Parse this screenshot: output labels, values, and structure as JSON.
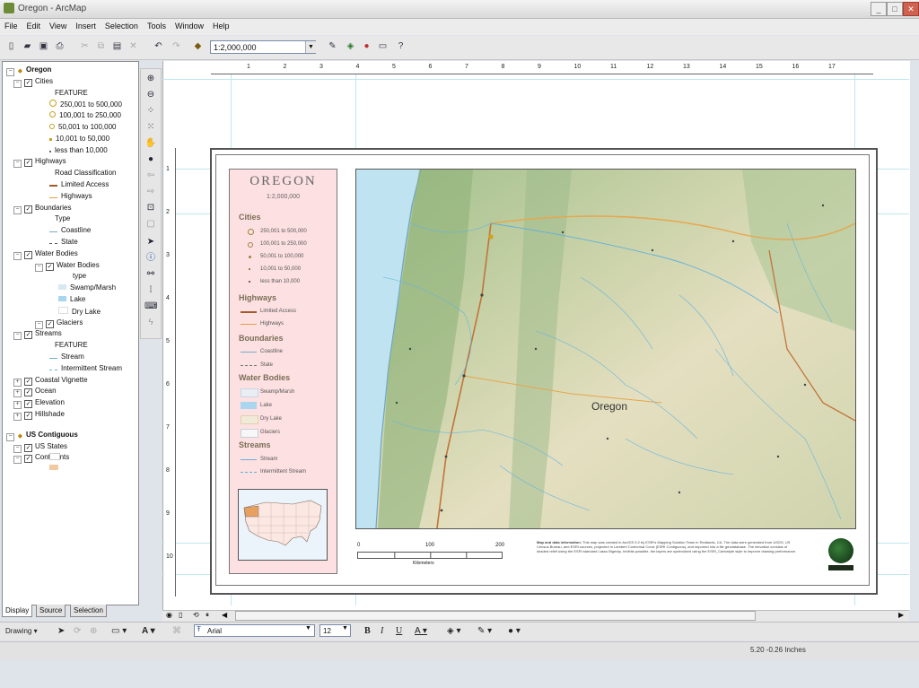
{
  "window": {
    "title": "Oregon - ArcMap"
  },
  "menu": [
    "File",
    "Edit",
    "View",
    "Insert",
    "Selection",
    "Tools",
    "Window",
    "Help"
  ],
  "toolbar": {
    "scale": "1:2,000,000"
  },
  "toc": {
    "items": [
      {
        "label": "Oregon",
        "kind": "frame"
      },
      {
        "label": "Cities",
        "kind": "layer"
      },
      {
        "label": "FEATURE",
        "kind": "sub"
      },
      {
        "label": "250,001 to 500,000",
        "kind": "class"
      },
      {
        "label": "100,001 to 250,000",
        "kind": "class"
      },
      {
        "label": "50,001 to 100,000",
        "kind": "class"
      },
      {
        "label": "10,001 to 50,000",
        "kind": "class"
      },
      {
        "label": "less than 10,000",
        "kind": "class"
      },
      {
        "label": "Highways",
        "kind": "layer"
      },
      {
        "label": "Road Classification",
        "kind": "sub"
      },
      {
        "label": "Limited Access",
        "kind": "class"
      },
      {
        "label": "Highways",
        "kind": "class"
      },
      {
        "label": "Boundaries",
        "kind": "layer"
      },
      {
        "label": "Type",
        "kind": "sub"
      },
      {
        "label": "Coastline",
        "kind": "class"
      },
      {
        "label": "State",
        "kind": "class"
      },
      {
        "label": "Water Bodies",
        "kind": "layer"
      },
      {
        "label": "Water Bodies",
        "kind": "sublayer"
      },
      {
        "label": "type",
        "kind": "sub2"
      },
      {
        "label": "Swamp/Marsh",
        "kind": "class2"
      },
      {
        "label": "Lake",
        "kind": "class2"
      },
      {
        "label": "Dry Lake",
        "kind": "class2"
      },
      {
        "label": "Glaciers",
        "kind": "sublayer"
      },
      {
        "label": "Streams",
        "kind": "layer"
      },
      {
        "label": "FEATURE",
        "kind": "sub"
      },
      {
        "label": "Stream",
        "kind": "class"
      },
      {
        "label": "Intermittent Stream",
        "kind": "class"
      },
      {
        "label": "Coastal Vignette",
        "kind": "layer"
      },
      {
        "label": "Ocean",
        "kind": "layer"
      },
      {
        "label": "Elevation",
        "kind": "layer"
      },
      {
        "label": "Hillshade",
        "kind": "layer"
      },
      {
        "label": "US Contiguous",
        "kind": "frame"
      },
      {
        "label": "US States",
        "kind": "layer"
      },
      {
        "label": "Continents",
        "kind": "layer"
      }
    ],
    "tabs": [
      "Display",
      "Source",
      "Selection"
    ]
  },
  "ruler_ticks": [
    "1",
    "2",
    "3",
    "4",
    "5",
    "6",
    "7",
    "8",
    "9",
    "10",
    "11",
    "12",
    "13",
    "14",
    "15",
    "16",
    "17"
  ],
  "ruler_v_ticks": [
    "1",
    "2",
    "3",
    "4",
    "5",
    "6",
    "7",
    "8",
    "9",
    "10"
  ],
  "legend": {
    "title": "OREGON",
    "scale": "1:2,000,000",
    "cities_heading": "Cities",
    "cities": [
      "250,001 to 500,000",
      "100,001 to 250,000",
      "50,001 to 100,000",
      "10,001 to 50,000",
      "less than 10,000"
    ],
    "highways_heading": "Highways",
    "highways": [
      "Limited Access",
      "Highways"
    ],
    "boundaries_heading": "Boundaries",
    "boundaries": [
      "Coastline",
      "State"
    ],
    "water_heading": "Water Bodies",
    "water": [
      "Swamp/Marsh",
      "Lake",
      "Dry Lake",
      "Glaciers"
    ],
    "streams_heading": "Streams",
    "streams": [
      "Stream",
      "Intermittent Stream"
    ]
  },
  "map": {
    "label": "Oregon"
  },
  "scalebar": {
    "ticks": [
      "0",
      "100",
      "200"
    ],
    "units": "Kilometers"
  },
  "note": {
    "heading": "Map and data information:",
    "text": "This map was created in ArcGIS 9.2 by ESRI's Mapping Solution Team in Redlands, CA. The data were generated from USGS, US Census Bureau, and ESRI sources, projected in Lambert Conformal Conic (ESRI Contiguous), and imported into a file geodatabase. The elevation consists of shaded relief using the ESRI standard Lasso Bigmap, Inhibits possible, the layers are symbolized using the ESRI_Cartostyle style to improve drawing performance."
  },
  "drawing": {
    "label": "Drawing",
    "font": "Arial",
    "size": "12"
  },
  "status": {
    "coords": "5.20  -0.26 Inches"
  },
  "colors": {
    "legend_bg": "#fde0e2",
    "heading": "#7a6e55",
    "ocean": "#bfe3f0"
  }
}
